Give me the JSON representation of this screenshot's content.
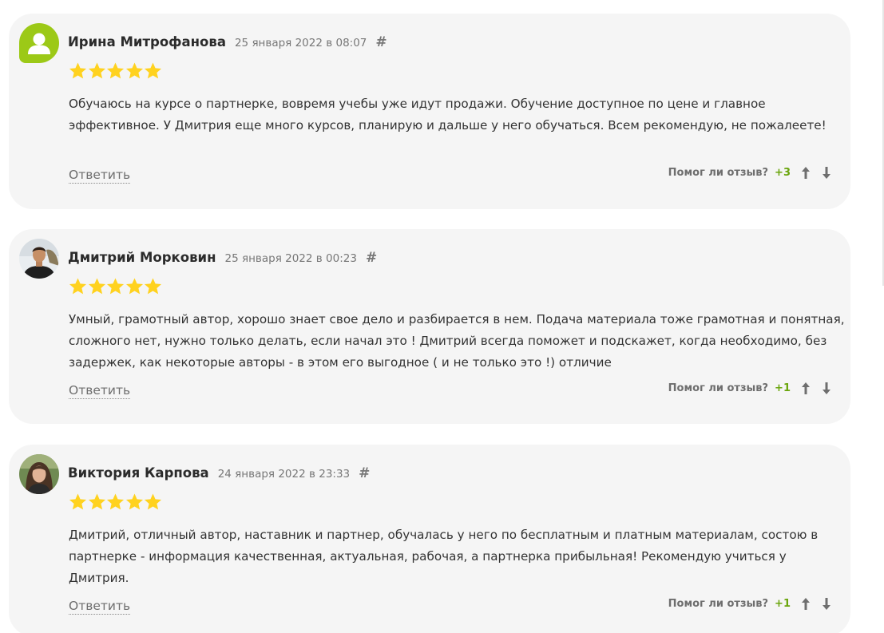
{
  "colors": {
    "card_bg": "#f5f5f5",
    "star": "#ffd21f",
    "positive": "#6aa50c",
    "avatar_default": "#9cc917"
  },
  "reviews": [
    {
      "author": "Ирина Митрофанова",
      "date": "25 января 2022 в 08:07",
      "anchor": "#",
      "rating": 5,
      "text": "Обучаюсь на курсе о партнерке, вовремя учебы уже идут продажи. Обучение доступное по цене и главное эффективное. У Дмитрия еще много курсов, планирую и дальше у него обучаться. Всем рекомендую, не пожалеете!",
      "reply_label": "Ответить",
      "helpful_label": "Помог ли отзыв?",
      "helpful_count": "+3",
      "avatar_icon": "user-silhouette-icon"
    },
    {
      "author": "Дмитрий Морковин",
      "date": "25 января 2022 в 00:23",
      "anchor": "#",
      "rating": 5,
      "text": "Умный, грамотный автор, хорошо знает свое дело и разбирается в нем. Подача материала тоже грамотная и понятная, сложного нет, нужно только делать, если начал это ! Дмитрий всегда поможет и подскажет, когда необходимо, без задержек, как некоторые авторы - в этом его выгодное ( и не только это !) отличие",
      "reply_label": "Ответить",
      "helpful_label": "Помог ли отзыв?",
      "helpful_count": "+1",
      "avatar_icon": "user-photo"
    },
    {
      "author": "Виктория Карпова",
      "date": "24 января 2022 в 23:33",
      "anchor": "#",
      "rating": 5,
      "text": "Дмитрий, отличный автор, наставник и партнер, обучалась у него по бесплатным и платным материалам, состою в партнерке - информация качественная, актуальная, рабочая, а партнерка прибыльная! Рекомендую учиться у Дмитрия.",
      "reply_label": "Ответить",
      "helpful_label": "Помог ли отзыв?",
      "helpful_count": "+1",
      "avatar_icon": "user-photo"
    }
  ]
}
